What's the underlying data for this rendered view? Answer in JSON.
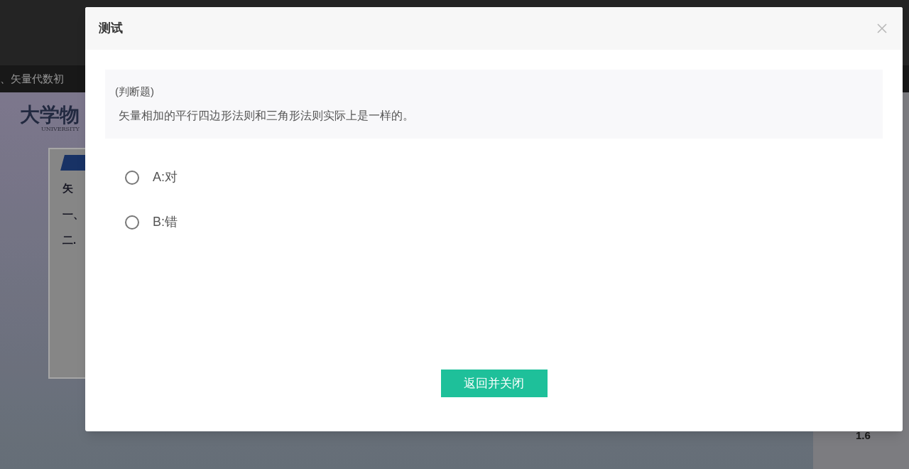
{
  "background": {
    "caption": "、矢量代数初",
    "slide": {
      "logo": "大学物",
      "logo_subtitle": "UNIVERSITY",
      "lines": [
        "矢",
        "一、",
        "二."
      ]
    },
    "side_number": "1.6"
  },
  "dialog": {
    "title": "测试",
    "question": {
      "type_label": "(判断题)",
      "text": "矢量相加的平行四边形法则和三角形法则实际上是一样的。"
    },
    "options": [
      {
        "label": "A:对",
        "selected": false
      },
      {
        "label": "B:错",
        "selected": false
      }
    ],
    "button": "返回并关闭"
  }
}
